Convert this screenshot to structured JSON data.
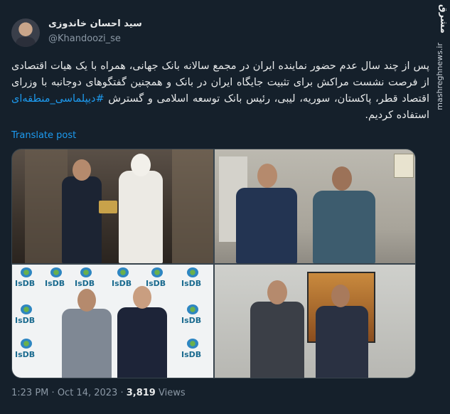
{
  "author": {
    "display_name": "سید احسان خاندوزی",
    "handle": "@Khandoozi_se"
  },
  "watermark": {
    "logo": "مشرق",
    "url": "mashreghnews.ir"
  },
  "tweet": {
    "text_before_hashtag": "پس از چند سال عدم حضور نماینده ایران در مجمع سالانه بانک جهانی، همراه با یک هیات اقتصادی از فرصت نشست مراکش برای تثبیت جایگاه ایران در بانک و همچنین گفتگوهای دوجانبه با وزرای اقتصاد قطر، پاکستان، سوریه، لیبی، رئیس بانک توسعه اسلامی و گسترش",
    "hashtag": "#دیپلماسی_منطقه‌ای",
    "text_after_hashtag": "استفاده کردیم.",
    "translate_label": "Translate post"
  },
  "media": {
    "isdb_label": "IsDB"
  },
  "footer": {
    "time": "1:23 PM",
    "separator": "·",
    "date": "Oct 14, 2023",
    "views_count": "3,819",
    "views_label": "Views"
  }
}
